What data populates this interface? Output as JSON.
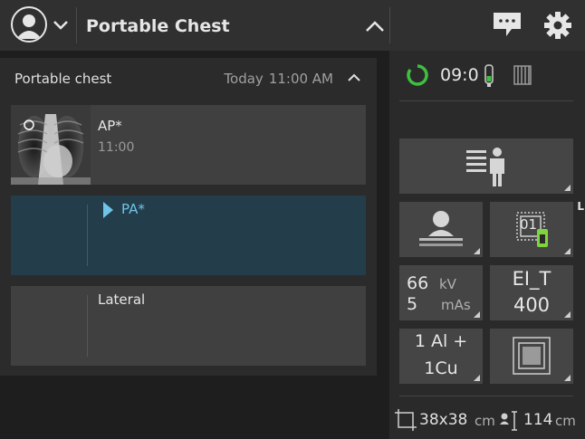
{
  "topbar": {
    "title": "Portable Chest"
  },
  "exam_panel": {
    "header": "Portable chest",
    "date": "Today",
    "time": "11:00 AM",
    "exams": [
      {
        "name": "AP*",
        "time": "11:00",
        "state": "done"
      },
      {
        "name": "PA*",
        "time": "",
        "state": "selected"
      },
      {
        "name": "Lateral",
        "time": "",
        "state": "pending"
      }
    ]
  },
  "status": {
    "clock": "09:0",
    "indicator_color": "#3fbf3f"
  },
  "tiles": {
    "detector_label": "01",
    "detector_side": "L",
    "kv_value": "66",
    "kv_unit": "kV",
    "mas_value": "5",
    "mas_unit": "mAs",
    "ei_label": "EI_T",
    "ei_value": "400",
    "filter_line1": "1 Al +",
    "filter_line2": "1Cu"
  },
  "bottom": {
    "field_size": "38x38",
    "field_unit": "cm",
    "sid_value": "114",
    "sid_unit": "cm"
  },
  "colors": {
    "accent": "#6fc3e8",
    "battery": "#7fd63a",
    "ok": "#3fbf3f"
  },
  "icons": [
    "user-avatar-icon",
    "chevron-down-icon",
    "chevron-up-icon",
    "chat-icon",
    "gear-icon",
    "status-ring-icon",
    "battery-icon",
    "grid-icon",
    "patient-list-icon",
    "patient-position-icon",
    "detector-icon",
    "collimator-icon",
    "field-size-icon",
    "sid-icon"
  ]
}
